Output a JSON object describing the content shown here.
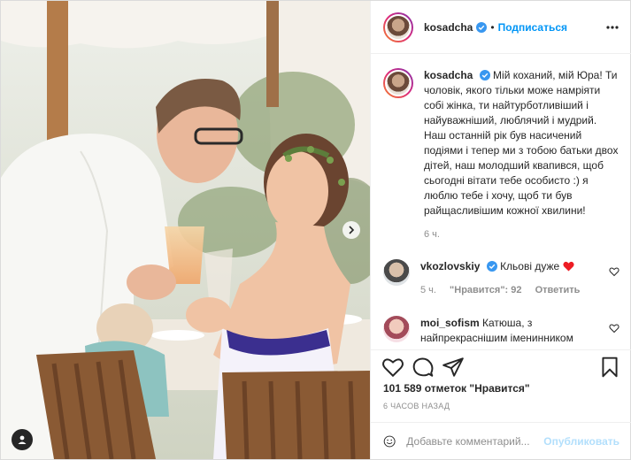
{
  "header": {
    "username": "kosadcha",
    "separator": "•",
    "follow_label": "Подписаться"
  },
  "caption": {
    "username": "kosadcha",
    "text": "Мій коханий, мій Юра! Ти чоловік, якого тільки може намріяти собі жінка, ти найтурботливіший і найуважніший, люблячий і мудрий. Наш останній рік був насичений подіями і тепер ми з тобою батьки двох дітей, наш молодший квапився, щоб сьогодні вітати тебе особисто :) я люблю тебе і хочу, щоб ти був райщасливішим кожної хвилини!",
    "time": "6 ч."
  },
  "comments": [
    {
      "username": "vkozlovskiy",
      "text": "Кльові дуже",
      "emoji": "heart-red",
      "time": "5 ч.",
      "likes": "\"Нравится\": 92",
      "reply_label": "Ответить"
    },
    {
      "username": "moi_sofism",
      "text": "Катюша, з найпрекраснішим іменинником"
    }
  ],
  "actions": {
    "likes_count": "101 589 отметок \"Нравится\"",
    "timestamp": "6 ЧАСОВ НАЗАД",
    "comment_placeholder": "Добавьте комментарий...",
    "publish_label": "Опубликовать"
  },
  "icons": {
    "like": "heart-icon",
    "comment": "comment-icon",
    "share": "share-icon",
    "save": "bookmark-icon",
    "more": "more-horizontal-icon",
    "emoji": "emoji-icon",
    "next": "chevron-right-icon",
    "tags": "user-tag-icon"
  },
  "colors": {
    "accent": "#0095f6",
    "verified": "#3897f0",
    "text": "#262626",
    "muted": "#8e8e8e",
    "heart": "#ed4956"
  }
}
